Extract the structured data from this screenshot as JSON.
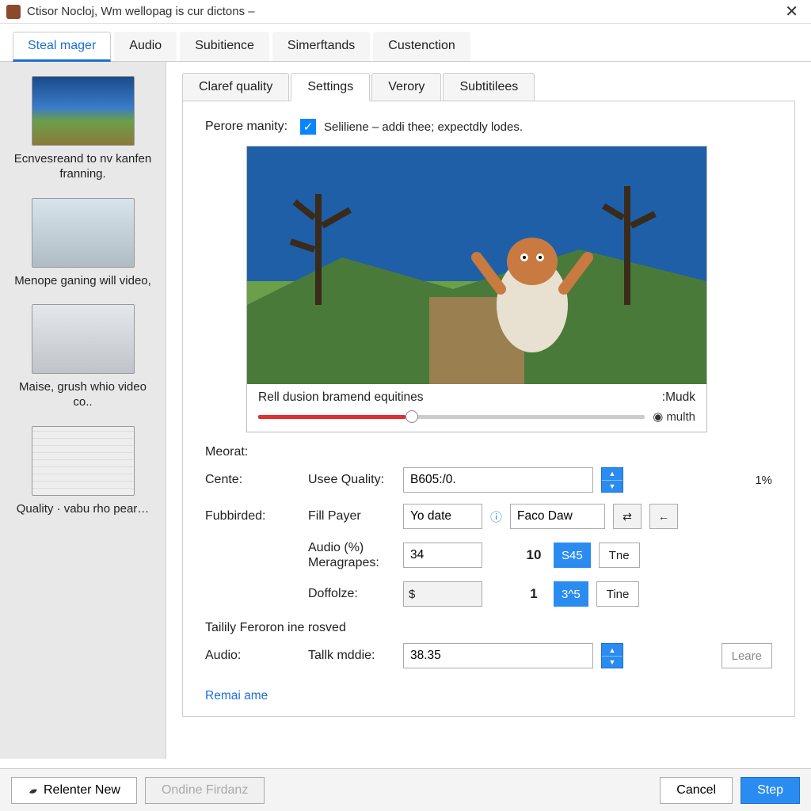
{
  "window": {
    "title": "Ctisor Nocloj, Wm wellopag is cur dictons –"
  },
  "outer_tabs": [
    "Steal mager",
    "Audio",
    "Subitience",
    "Simerftands",
    "Custenction"
  ],
  "outer_active": 0,
  "sidebar": {
    "items": [
      {
        "label": "Ecnvesreand to nv kanfen franning."
      },
      {
        "label": "Menope ganing will video,"
      },
      {
        "label": "Maise, grush whio video co.."
      },
      {
        "label": "Quality · vabu rho pear…"
      }
    ]
  },
  "inner_tabs": [
    "Claref quality",
    "Settings",
    "Verory",
    "Subtitilees"
  ],
  "inner_active": 1,
  "settings": {
    "perore_label": "Perore manity:",
    "perore_checked": true,
    "perore_text": "Seliliene – addi thee; expectdly lodes.",
    "preview_caption": "Rell dusion bramend equitines",
    "mudk": ":Mudk",
    "mulith": "multh",
    "meorat": "Meorat:",
    "rows": {
      "cente": "Cente:",
      "use_quality": "Usee Quality:",
      "use_quality_val": "B605:/0.",
      "use_quality_suffix": "1%",
      "fubbirded": "Fubbirded:",
      "fill_payer": "Fill Payer",
      "yo_date": "Yo date",
      "faco_daw": "Faco Daw",
      "audio_label": "Audio (%)",
      "meragrapes": "Meragrapes:",
      "audio_val": "34",
      "audio_bold": "10",
      "audio_btn": "S45",
      "audio_tne": "Tne",
      "doffolze": "Doffolze:",
      "doffolze_prefix": "$",
      "doffolze_val": "",
      "doffolze_bold": "1",
      "doffolze_btn": "3^5",
      "doffolze_tine": "Tine"
    },
    "tailily": "Tailily Feroron ine rosved",
    "audio_section": "Audio:",
    "talk_mddie": "Tallk mddie:",
    "talk_val": "38.35",
    "leare": "Leare",
    "remai": "Remai ame"
  },
  "footer": {
    "relenter": "Relenter New",
    "online": "Ondine Firdanz",
    "cancel": "Cancel",
    "step": "Step"
  },
  "icons": {
    "close": "✕",
    "check": "✓",
    "arrows": "⇄",
    "left": "←",
    "circ": "◉",
    "info": "ⓘ"
  }
}
